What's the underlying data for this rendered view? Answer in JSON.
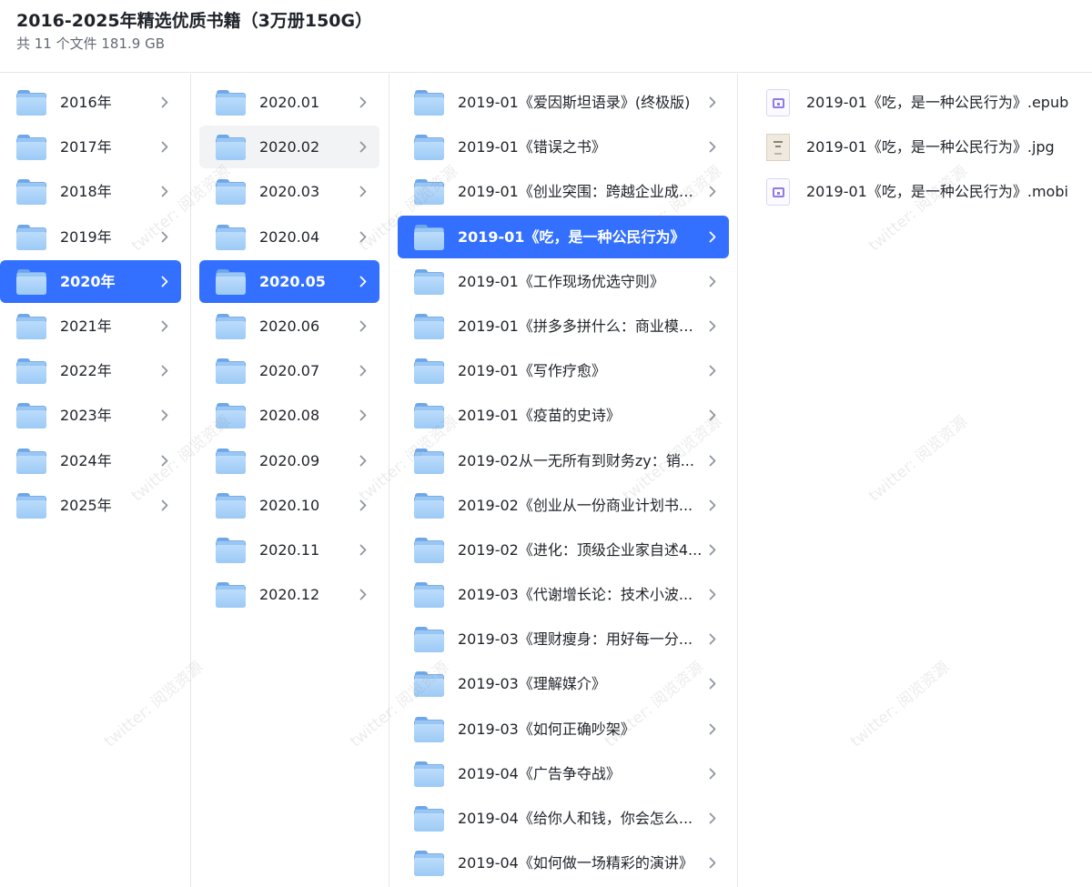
{
  "header": {
    "title": "2016-2025年精选优质书籍（3万册150G）",
    "meta": "共 11 个文件 181.9 GB"
  },
  "years": [
    {
      "label": "2016年"
    },
    {
      "label": "2017年"
    },
    {
      "label": "2018年"
    },
    {
      "label": "2019年"
    },
    {
      "label": "2020年",
      "selected": true
    },
    {
      "label": "2021年"
    },
    {
      "label": "2022年"
    },
    {
      "label": "2023年"
    },
    {
      "label": "2024年"
    },
    {
      "label": "2025年"
    }
  ],
  "months": [
    {
      "label": "2020.01"
    },
    {
      "label": "2020.02",
      "hover": true
    },
    {
      "label": "2020.03"
    },
    {
      "label": "2020.04"
    },
    {
      "label": "2020.05",
      "selected": true
    },
    {
      "label": "2020.06"
    },
    {
      "label": "2020.07"
    },
    {
      "label": "2020.08"
    },
    {
      "label": "2020.09"
    },
    {
      "label": "2020.10"
    },
    {
      "label": "2020.11"
    },
    {
      "label": "2020.12"
    }
  ],
  "books": [
    {
      "label": "2019-01《爱因斯坦语录》(终极版)"
    },
    {
      "label": "2019-01《错误之书》"
    },
    {
      "label": "2019-01《创业突围：跨越企业成长..."
    },
    {
      "label": "2019-01《吃，是一种公民行为》",
      "selected": true
    },
    {
      "label": "2019-01《工作现场优选守则》"
    },
    {
      "label": "2019-01《拼多多拼什么：商业模式..."
    },
    {
      "label": "2019-01《写作疗愈》"
    },
    {
      "label": "2019-01《疫苗的史诗》"
    },
    {
      "label": "2019-02从一无所有到财务zy：销..."
    },
    {
      "label": "2019-02《创业从一份商业计划书..."
    },
    {
      "label": "2019-02《进化：顶级企业家自述4..."
    },
    {
      "label": "2019-03《代谢增长论：技术小波..."
    },
    {
      "label": "2019-03《理财瘦身：用好每一分..."
    },
    {
      "label": "2019-03《理解媒介》"
    },
    {
      "label": "2019-03《如何正确吵架》"
    },
    {
      "label": "2019-04《广告争夺战》"
    },
    {
      "label": "2019-04《给你人和钱，你会怎么..."
    },
    {
      "label": "2019-04《如何做一场精彩的演讲》"
    }
  ],
  "files": [
    {
      "label": "2019-01《吃，是一种公民行为》.epub",
      "icon": "ebook-icon"
    },
    {
      "label": "2019-01《吃，是一种公民行为》.jpg",
      "icon": "image-thumbnail-icon"
    },
    {
      "label": "2019-01《吃，是一种公民行为》.mobi",
      "icon": "ebook-icon"
    }
  ],
  "watermark": "twitter: 阅览资源",
  "colors": {
    "selected": "#3370ff",
    "folder": "#8fbff3",
    "border": "#e5e6eb"
  }
}
